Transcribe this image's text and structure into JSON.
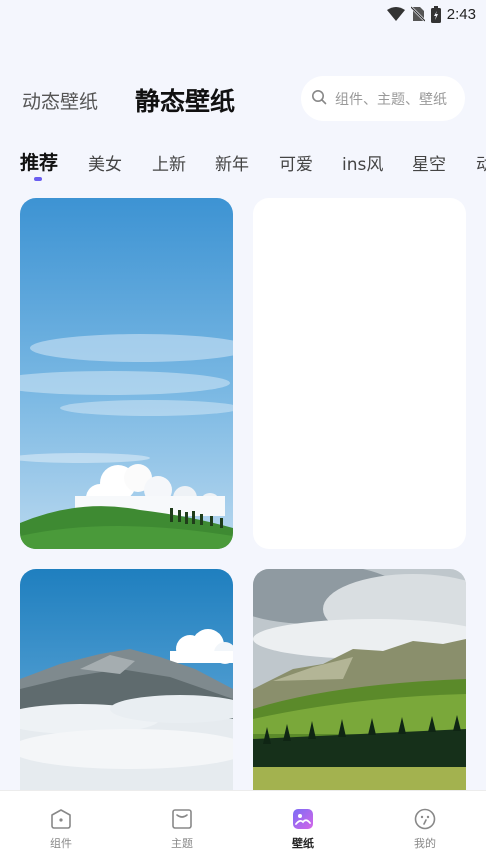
{
  "status_bar": {
    "time": "2:43",
    "icons": [
      "wifi-icon",
      "no-sim-icon",
      "battery-icon"
    ]
  },
  "header": {
    "tabs": [
      {
        "label": "动态壁纸",
        "active": false
      },
      {
        "label": "静态壁纸",
        "active": true
      }
    ],
    "search": {
      "placeholder": "组件、主题、壁纸",
      "icon": "search-icon"
    }
  },
  "categories": [
    {
      "label": "推荐",
      "active": true
    },
    {
      "label": "美女",
      "active": false
    },
    {
      "label": "上新",
      "active": false
    },
    {
      "label": "新年",
      "active": false
    },
    {
      "label": "可爱",
      "active": false
    },
    {
      "label": "ins风",
      "active": false
    },
    {
      "label": "星空",
      "active": false
    },
    {
      "label": "动",
      "active": false
    }
  ],
  "wallpapers": [
    {
      "name": "blue-sky-green-hill"
    },
    {
      "name": "blank-loading"
    },
    {
      "name": "mountain-clouds-valley"
    },
    {
      "name": "green-mountain-meadow"
    }
  ],
  "bottom_nav": [
    {
      "label": "组件",
      "icon": "widget-icon",
      "active": false
    },
    {
      "label": "主题",
      "icon": "theme-icon",
      "active": false
    },
    {
      "label": "壁纸",
      "icon": "wallpaper-icon",
      "active": true
    },
    {
      "label": "我的",
      "icon": "profile-icon",
      "active": false
    }
  ],
  "colors": {
    "accent": "#6a5ef0",
    "background": "#f4f6fd"
  }
}
